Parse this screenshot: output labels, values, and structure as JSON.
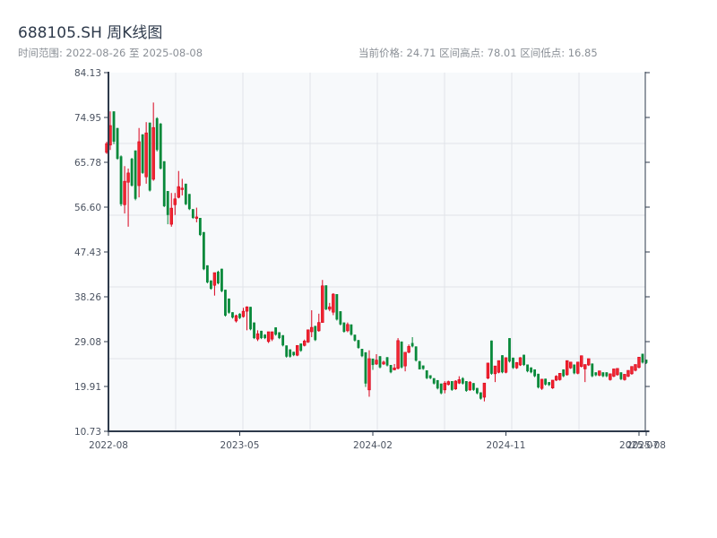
{
  "header": {
    "title": "688105.SH 周K线图",
    "range_text": "时间范围: 2022-08-26 至 2025-08-08",
    "stats_text": "当前价格: 24.71  区间高点: 78.01  区间低点: 16.85"
  },
  "chart_data": {
    "type": "candlestick",
    "title": "688105.SH 周K线图",
    "ylim": [
      10.73,
      84.13
    ],
    "y_ticks": [
      "84.13",
      "74.95",
      "65.78",
      "56.60",
      "47.43",
      "38.26",
      "29.08",
      "19.91",
      "10.73"
    ],
    "x_ticks": [
      {
        "label": "2022-08",
        "index": 0
      },
      {
        "label": "2023-05",
        "index": 37
      },
      {
        "label": "2024-02",
        "index": 74
      },
      {
        "label": "2024-11",
        "index": 111
      },
      {
        "label": "2025-07",
        "index": 148
      },
      {
        "label": "2025-08",
        "index": 150
      }
    ],
    "grid": true,
    "colors": {
      "up": "#d9001b",
      "up_fill": "#f0262f",
      "down": "#07893a",
      "background": "#f7f9fb",
      "axis": "#2e3a4b",
      "grid": "#e1e4e8"
    },
    "ohlc_fields": [
      "open",
      "high",
      "low",
      "close"
    ],
    "ohlc": [
      [
        67.8,
        70,
        67.5,
        69.6
      ],
      [
        69.3,
        76.2,
        68.3,
        73.3
      ],
      [
        76.2,
        76.2,
        69.5,
        70
      ],
      [
        72.8,
        72.8,
        66.3,
        66.5
      ],
      [
        67,
        67.2,
        56.8,
        57.2
      ],
      [
        57.1,
        65,
        55.3,
        61.9
      ],
      [
        61.7,
        64.5,
        52.6,
        63.6
      ],
      [
        66.5,
        66.7,
        60.8,
        61
      ],
      [
        68.2,
        68.2,
        58,
        58.3
      ],
      [
        61,
        72.8,
        58.6,
        70
      ],
      [
        71.5,
        71.5,
        63.4,
        63.6
      ],
      [
        62.8,
        74,
        61.4,
        71.8
      ],
      [
        73.9,
        73.9,
        59.8,
        60
      ],
      [
        62.3,
        78.01,
        62,
        72.9
      ],
      [
        74.8,
        75,
        68,
        68.3
      ],
      [
        73.7,
        73.8,
        64.3,
        64.5
      ],
      [
        66,
        66,
        56.6,
        56.8
      ],
      [
        59.9,
        59.9,
        53.1,
        55
      ],
      [
        53.1,
        59.5,
        52.6,
        56.4
      ],
      [
        57.1,
        59.5,
        55,
        58.3
      ],
      [
        58.6,
        64,
        58.4,
        60.8
      ],
      [
        60.2,
        62.4,
        59,
        60.5
      ],
      [
        61.4,
        61.4,
        57,
        57.2
      ],
      [
        59.3,
        59.3,
        56,
        56.2
      ],
      [
        56.2,
        56.2,
        54.2,
        54.4
      ],
      [
        54.3,
        56.5,
        53.5,
        54.6
      ],
      [
        54.4,
        54.4,
        50.7,
        50.9
      ],
      [
        51.5,
        51.5,
        43.7,
        43.9
      ],
      [
        44.7,
        44.7,
        41,
        41.2
      ],
      [
        41.6,
        41.6,
        39.7,
        39.9
      ],
      [
        40.6,
        43.2,
        38.5,
        43.2
      ],
      [
        43.4,
        43.6,
        40.8,
        41
      ],
      [
        44,
        44,
        39.2,
        39.4
      ],
      [
        39.7,
        39.7,
        34.2,
        34.4
      ],
      [
        37.9,
        37.9,
        34.8,
        35
      ],
      [
        35.1,
        35.1,
        33.8,
        34
      ],
      [
        33.3,
        34.6,
        33,
        34.4
      ],
      [
        34.8,
        34.9,
        33.7,
        33.9
      ],
      [
        34.2,
        36,
        34,
        35.3
      ],
      [
        35.3,
        36.3,
        31.4,
        36.2
      ],
      [
        36.2,
        36.2,
        31.4,
        31.6
      ],
      [
        33,
        33,
        29.6,
        29.8
      ],
      [
        29.6,
        31.4,
        29.2,
        30.7
      ],
      [
        31.3,
        31.3,
        29.6,
        29.8
      ],
      [
        30.5,
        30.6,
        29.6,
        29.8
      ],
      [
        29.1,
        31.1,
        28.8,
        31.1
      ],
      [
        29.6,
        31.1,
        29.2,
        31.1
      ],
      [
        32,
        32,
        30.3,
        30.5
      ],
      [
        31,
        31,
        29.6,
        29.8
      ],
      [
        30.4,
        30.4,
        28.1,
        28.3
      ],
      [
        28.3,
        28.3,
        25.8,
        26
      ],
      [
        27.5,
        27.5,
        25.8,
        26
      ],
      [
        27,
        27,
        26.1,
        26.3
      ],
      [
        26.3,
        28.3,
        26.1,
        28.3
      ],
      [
        28.7,
        28.7,
        27,
        27.2
      ],
      [
        28.3,
        29.5,
        28.1,
        29.2
      ],
      [
        29,
        31.5,
        28.8,
        31.5
      ],
      [
        31.1,
        35.5,
        30,
        32
      ],
      [
        32.3,
        32.3,
        29.2,
        29.4
      ],
      [
        31.3,
        34.8,
        31.1,
        33
      ],
      [
        33,
        41.7,
        33,
        40.5
      ],
      [
        40.6,
        40.6,
        35.5,
        35.7
      ],
      [
        35.7,
        37,
        35.3,
        36.2
      ],
      [
        35.1,
        39,
        34.5,
        38.8
      ],
      [
        38.8,
        38.8,
        33.4,
        33.6
      ],
      [
        35.3,
        35.3,
        32.4,
        32.6
      ],
      [
        33,
        33,
        30.9,
        31.1
      ],
      [
        31.3,
        33,
        31,
        32.6
      ],
      [
        32.6,
        32.6,
        30.3,
        30.5
      ],
      [
        30.5,
        30.5,
        29.1,
        29.3
      ],
      [
        29.4,
        29.4,
        27.6,
        27.8
      ],
      [
        27.6,
        27.6,
        25.9,
        26.1
      ],
      [
        26.9,
        26.9,
        19.8,
        20.5
      ],
      [
        19.2,
        27.3,
        17.8,
        25.6
      ],
      [
        25.6,
        25.6,
        23.3,
        24.3
      ],
      [
        24.5,
        26.5,
        24.3,
        25.3
      ],
      [
        26.1,
        26.1,
        23.6,
        23.8
      ],
      [
        24.5,
        25.2,
        24.3,
        24.9
      ],
      [
        25.9,
        25.9,
        24,
        24.2
      ],
      [
        24.3,
        24.3,
        22.6,
        22.8
      ],
      [
        23.3,
        24.5,
        23.2,
        23.7
      ],
      [
        23.6,
        29.8,
        23.4,
        29.3
      ],
      [
        29.1,
        29.1,
        23.6,
        23.8
      ],
      [
        24.1,
        26.9,
        23,
        26.9
      ],
      [
        26.9,
        28.5,
        26.7,
        28.1
      ],
      [
        28.8,
        30,
        27.9,
        28.1
      ],
      [
        28.1,
        28.1,
        25,
        25.2
      ],
      [
        25.1,
        25.1,
        23.4,
        23.4
      ],
      [
        24.2,
        24.2,
        23.3,
        23.5
      ],
      [
        23.2,
        23.2,
        21.4,
        21.6
      ],
      [
        22.2,
        22.2,
        21.4,
        21.6
      ],
      [
        21.6,
        21.6,
        20.3,
        20.5
      ],
      [
        21.2,
        21.2,
        19.3,
        19.5
      ],
      [
        20.5,
        20.5,
        18.3,
        18.5
      ],
      [
        19.2,
        21,
        18.5,
        20.6
      ],
      [
        20.3,
        21.1,
        20.1,
        20.9
      ],
      [
        21,
        21,
        19,
        19.2
      ],
      [
        19.4,
        21.2,
        19.2,
        21
      ],
      [
        20.6,
        22,
        20.4,
        21.3
      ],
      [
        21.6,
        21.8,
        20.3,
        20.5
      ],
      [
        21,
        21,
        18.8,
        19
      ],
      [
        19.2,
        21,
        19,
        20.8
      ],
      [
        20.6,
        20.6,
        19,
        19.2
      ],
      [
        19.6,
        19.6,
        18.3,
        18.5
      ],
      [
        18.7,
        18.7,
        17.2,
        17.4
      ],
      [
        17.7,
        20.6,
        16.85,
        20.6
      ],
      [
        21.6,
        24.7,
        21.4,
        24.7
      ],
      [
        29.3,
        29.3,
        22.3,
        22.5
      ],
      [
        22.5,
        24.1,
        20.8,
        24.1
      ],
      [
        22.8,
        25.2,
        22.6,
        25.2
      ],
      [
        26.3,
        26.3,
        22.6,
        22.8
      ],
      [
        22.8,
        25.8,
        22.6,
        25.8
      ],
      [
        29.8,
        29.8,
        24.8,
        25
      ],
      [
        25.8,
        25.8,
        23.5,
        23.7
      ],
      [
        23.7,
        24.9,
        23.5,
        24.8
      ],
      [
        24.3,
        25.9,
        24.1,
        25.8
      ],
      [
        26.4,
        26.4,
        24.1,
        24.3
      ],
      [
        24.4,
        24.4,
        22.8,
        23
      ],
      [
        23.8,
        23.8,
        22.6,
        22.8
      ],
      [
        23.4,
        23.4,
        21.8,
        22
      ],
      [
        22.5,
        22.5,
        19.5,
        19.7
      ],
      [
        19.5,
        21.4,
        19.2,
        21.4
      ],
      [
        21.5,
        21.5,
        20.1,
        20.3
      ],
      [
        20.8,
        20.8,
        20,
        20.2
      ],
      [
        19.6,
        21.2,
        19.4,
        21.2
      ],
      [
        21.2,
        22.2,
        21,
        22
      ],
      [
        21.3,
        22.6,
        21.1,
        22.6
      ],
      [
        23.4,
        23.4,
        21.8,
        22
      ],
      [
        22.3,
        25.2,
        22.1,
        25.2
      ],
      [
        23.7,
        24.9,
        23.5,
        24.9
      ],
      [
        24.4,
        24.4,
        22.4,
        22.6
      ],
      [
        22.6,
        24.9,
        22.4,
        24.9
      ],
      [
        24,
        26.2,
        23.8,
        26.2
      ],
      [
        23.5,
        24.4,
        20.8,
        24.4
      ],
      [
        24.3,
        25.6,
        24.1,
        25.6
      ],
      [
        24.6,
        24.6,
        21.8,
        22
      ],
      [
        22.8,
        22.8,
        22,
        22.2
      ],
      [
        22.2,
        23.1,
        22,
        23.1
      ],
      [
        22.8,
        22.8,
        21.8,
        22
      ],
      [
        22.8,
        22.8,
        21.8,
        22
      ],
      [
        21.3,
        22.5,
        21.1,
        22.5
      ],
      [
        22,
        23.5,
        21.8,
        23.5
      ],
      [
        22.3,
        23.6,
        22.1,
        23.6
      ],
      [
        22.8,
        22.8,
        21.2,
        21.4
      ],
      [
        21.3,
        22.4,
        21.1,
        22.4
      ],
      [
        22,
        23.2,
        21.8,
        23.2
      ],
      [
        22.5,
        24,
        22.3,
        24
      ],
      [
        23.2,
        24.4,
        23,
        24.4
      ],
      [
        23.8,
        25.9,
        23.6,
        25.9
      ],
      [
        26.6,
        26.6,
        24.6,
        24.8
      ],
      [
        25.4,
        25.4,
        24.5,
        24.71
      ]
    ]
  }
}
